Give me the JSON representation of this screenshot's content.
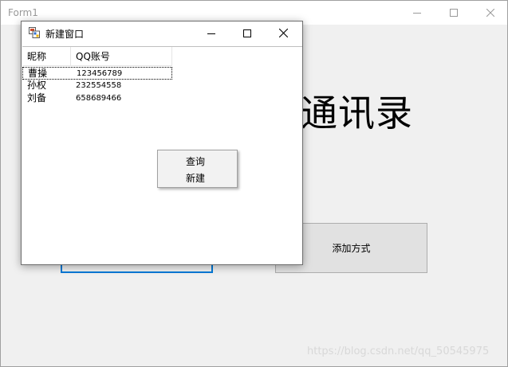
{
  "main_window": {
    "title": "Form1",
    "big_label": "通讯录",
    "add_button_label": "添加方式"
  },
  "child_window": {
    "title": "新建窗口",
    "listview": {
      "columns": [
        "昵称",
        "QQ账号"
      ],
      "rows": [
        {
          "name": "曹操",
          "qq": "123456789",
          "selected": true
        },
        {
          "name": "孙权",
          "qq": "232554558",
          "selected": false
        },
        {
          "name": "刘备",
          "qq": "658689466",
          "selected": false
        }
      ]
    }
  },
  "context_menu": {
    "items": [
      "查询",
      "新建"
    ]
  },
  "watermark": "https://blog.csdn.net/qq_50545975",
  "icons": {
    "minimize": "minimize-icon",
    "maximize": "maximize-icon",
    "close": "close-icon",
    "app": "app-icon"
  },
  "colors": {
    "accent_focus": "#0078d7",
    "button_bg": "#e1e1e1",
    "window_bg": "#f0f0f0"
  }
}
